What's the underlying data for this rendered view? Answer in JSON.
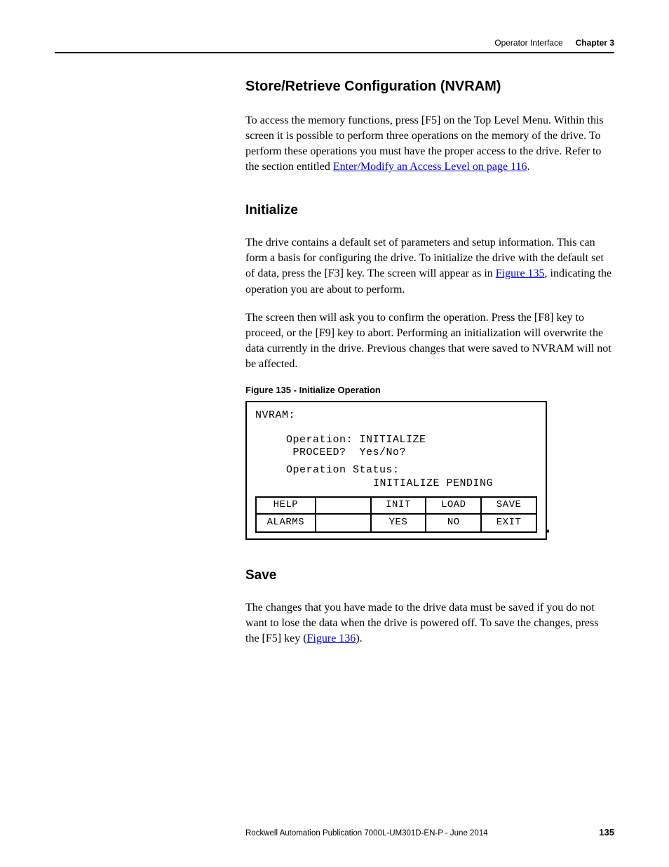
{
  "header": {
    "section": "Operator Interface",
    "chapter": "Chapter 3"
  },
  "sections": {
    "store": {
      "title": "Store/Retrieve Configuration (NVRAM)",
      "p1a": "To access the memory functions, press [F5] on the Top Level Menu. Within this screen it is possible to perform three operations on the memory of the drive. To perform these operations you must have the proper access to the drive. Refer to the section entitled ",
      "p1link": "Enter/Modify an Access Level  on page 116",
      "p1b": "."
    },
    "init": {
      "title": "Initialize",
      "p1a": "The drive contains a default set of parameters and setup information. This can form a basis for configuring the drive. To initialize the drive with the default set of data, press the [F3] key. The screen will appear as in ",
      "p1link": "Figure 135",
      "p1b": ", indicating the operation you are about to perform.",
      "p2": "The screen then will ask you to confirm the operation. Press the [F8] key to proceed, or the [F9] key to abort. Performing an initialization will overwrite the data currently in the drive. Previous changes that were saved to NVRAM will not be affected."
    },
    "figure": {
      "caption": "Figure 135 - Initialize Operation",
      "screen": {
        "title": "NVRAM:",
        "line1": "Operation: INITIALIZE",
        "line2": " PROCEED?  Yes/No?",
        "line3": "Operation Status:",
        "line4": "INITIALIZE PENDING"
      },
      "buttons": {
        "row1": {
          "c1": "HELP",
          "c2": "",
          "c3": "INIT",
          "c4": "LOAD",
          "c5": "SAVE"
        },
        "row2": {
          "c1": "ALARMS",
          "c2": "",
          "c3": "YES",
          "c4": "NO",
          "c5": "EXIT"
        }
      }
    },
    "save": {
      "title": "Save",
      "p1a": "The changes that you have made to the drive data must be saved if you do not want to lose the data when the drive is powered off. To save the changes, press the [F5] key (",
      "p1link": "Figure 136",
      "p1b": ")."
    }
  },
  "footer": {
    "publication": "Rockwell Automation Publication 7000L-UM301D-EN-P - June 2014",
    "page": "135"
  }
}
